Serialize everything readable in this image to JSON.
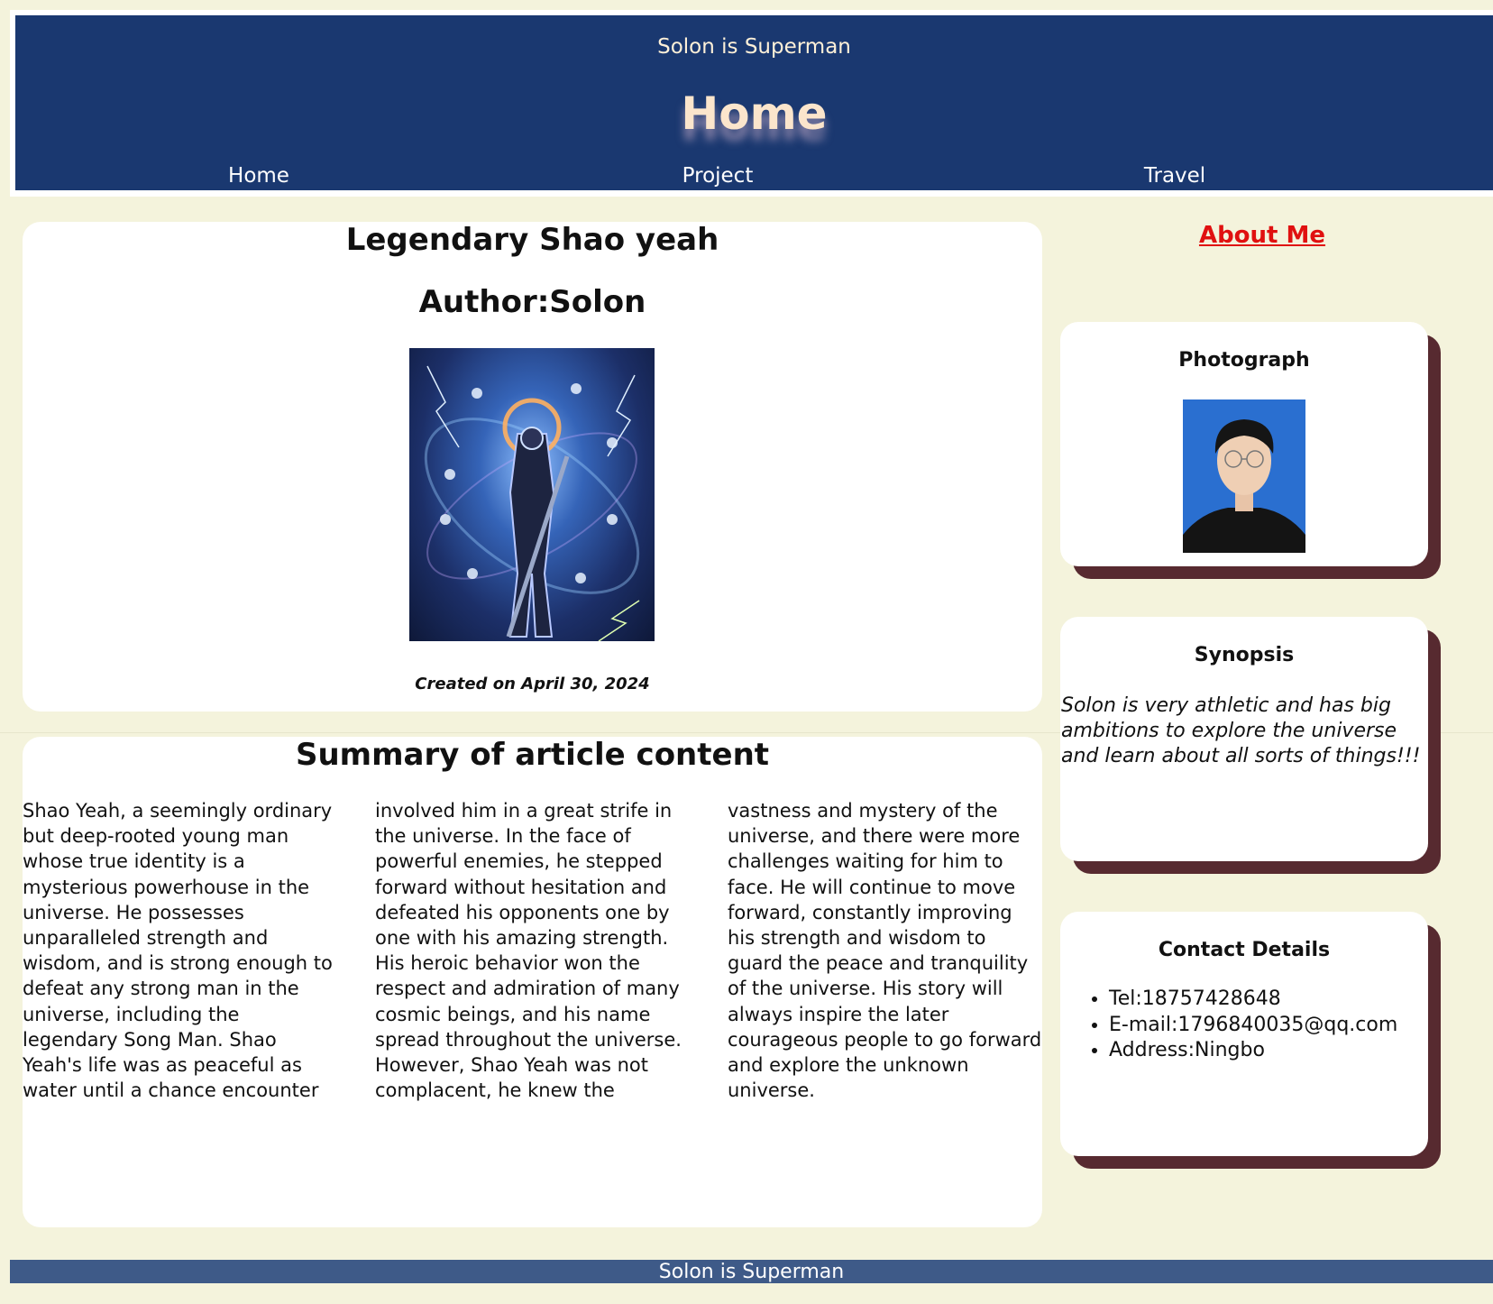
{
  "header": {
    "tagline": "Solon is Superman",
    "title": "Home",
    "nav": [
      {
        "label": "Home"
      },
      {
        "label": "Project"
      },
      {
        "label": "Travel"
      }
    ]
  },
  "article": {
    "title": "Legendary Shao yeah",
    "author": "Author:Solon",
    "cover_image": "armored-warrior-cosmic-illustration",
    "created": "Created on April 30, 2024"
  },
  "summary": {
    "title": "Summary of article content",
    "text": "Shao Yeah, a seemingly ordinary but deep-rooted young man whose true identity is a mysterious powerhouse in the universe. He possesses unparalleled strength and wisdom, and is strong enough to defeat any strong man in the universe, including the legendary Song Man. Shao Yeah's life was as peaceful as water until a chance encounter involved him in a great strife in the universe. In the face of powerful enemies, he stepped forward without hesitation and defeated his opponents one by one with his amazing strength. His heroic behavior won the respect and admiration of many cosmic beings, and his name spread throughout the universe. However, Shao Yeah was not complacent, he knew the vastness and mystery of the universe, and there were more challenges waiting for him to face. He will continue to move forward, constantly improving his strength and wisdom to guard the peace and tranquility of the universe. His story will always inspire the later courageous people to go forward and explore the unknown universe."
  },
  "sidebar": {
    "about_label": "About Me",
    "photo_title": "Photograph",
    "photo_image": "profile-portrait",
    "synopsis_title": "Synopsis",
    "synopsis_text": "Solon is very athletic and has big ambitions to explore the universe and learn about all sorts of things!!!",
    "contact_title": "Contact Details",
    "contacts": [
      {
        "text": "Tel:18757428648"
      },
      {
        "text": "E-mail:1796840035@qq.com"
      },
      {
        "text": "Address:Ningbo"
      }
    ]
  },
  "footer": {
    "text": "Solon is Superman"
  },
  "colors": {
    "page_background": "#f4f3dc",
    "header_background": "#1a3870",
    "footer_background": "#3e5a88",
    "about_link": "#e01010",
    "card_shadow": "#572a30"
  }
}
